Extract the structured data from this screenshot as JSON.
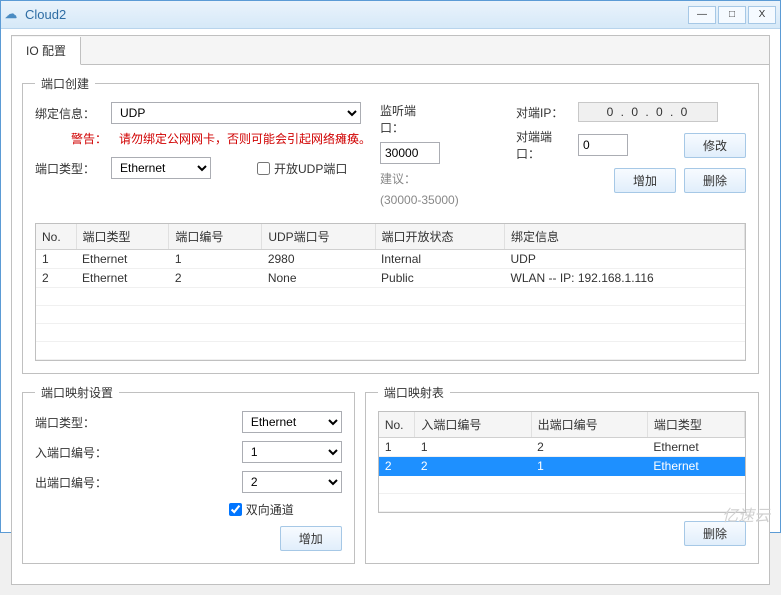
{
  "window": {
    "title": "Cloud2"
  },
  "tab": {
    "label": "IO 配置"
  },
  "portCreate": {
    "legend": "端口创建",
    "bindLabel": "绑定信息：",
    "bindValue": "UDP",
    "warningLabel": "警告：",
    "warningText": "请勿绑定公网网卡，否则可能会引起网络瘫痪。",
    "portTypeLabel": "端口类型：",
    "portTypeValue": "Ethernet",
    "openUdpLabel": "开放UDP端口",
    "listenPortLabel": "监听端口：",
    "listenPortValue": "30000",
    "suggestLabel": "建议：",
    "suggestRange": "(30000-35000)",
    "peerIpLabel": "对端IP：",
    "peerIpValue": "0  .  0  .  0  .  0",
    "peerPortLabel": "对端端口：",
    "peerPortValue": "0",
    "modifyBtn": "修改",
    "addBtn": "增加",
    "deleteBtn": "删除",
    "cols": {
      "no": "No.",
      "type": "端口类型",
      "num": "端口编号",
      "udp": "UDP端口号",
      "open": "端口开放状态",
      "bind": "绑定信息"
    },
    "rows": [
      {
        "no": "1",
        "type": "Ethernet",
        "num": "1",
        "udp": "2980",
        "open": "Internal",
        "bind": "UDP"
      },
      {
        "no": "2",
        "type": "Ethernet",
        "num": "2",
        "udp": "None",
        "open": "Public",
        "bind": "WLAN -- IP: 192.168.1.116"
      }
    ]
  },
  "mapSetting": {
    "legend": "端口映射设置",
    "portTypeLabel": "端口类型：",
    "portTypeValue": "Ethernet",
    "inLabel": "入端口编号：",
    "inValue": "1",
    "outLabel": "出端口编号：",
    "outValue": "2",
    "biDirLabel": "双向通道",
    "addBtn": "增加"
  },
  "mapTable": {
    "legend": "端口映射表",
    "cols": {
      "no": "No.",
      "in": "入端口编号",
      "out": "出端口编号",
      "type": "端口类型"
    },
    "rows": [
      {
        "no": "1",
        "in": "1",
        "out": "2",
        "type": "Ethernet"
      },
      {
        "no": "2",
        "in": "2",
        "out": "1",
        "type": "Ethernet"
      }
    ],
    "deleteBtn": "删除"
  },
  "watermark": "亿速云"
}
